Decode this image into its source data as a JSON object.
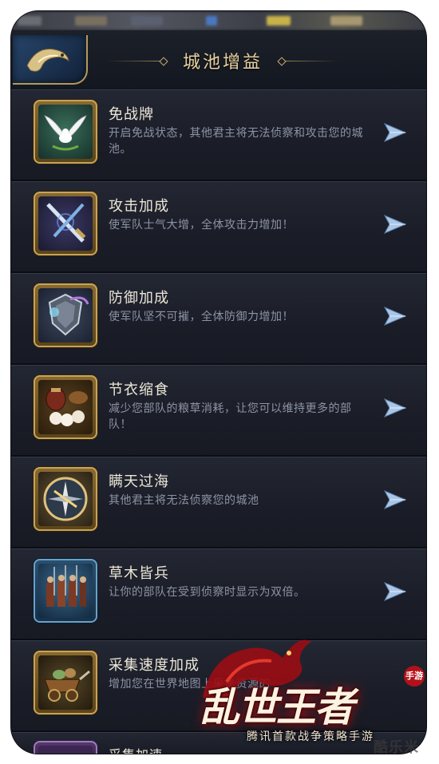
{
  "header": {
    "title": "城池增益"
  },
  "items": [
    {
      "name": "免战牌",
      "desc": "开启免战状态，其他君主将无法侦察和攻击您的城池。",
      "icon": "white-dove-icon"
    },
    {
      "name": "攻击加成",
      "desc": "使军队士气大增，全体攻击力增加！",
      "icon": "crossed-swords-icon"
    },
    {
      "name": "防御加成",
      "desc": "使军队坚不可摧，全体防御力增加！",
      "icon": "shield-armor-icon"
    },
    {
      "name": "节衣缩食",
      "desc": "减少您部队的粮草消耗，让您可以维持更多的部队！",
      "icon": "food-jar-buns-icon"
    },
    {
      "name": "瞒天过海",
      "desc": "其他君主将无法侦察您的城池",
      "icon": "compass-map-icon"
    },
    {
      "name": "草木皆兵",
      "desc": "让你的部队在受到侦察时显示为双倍。",
      "icon": "soldiers-group-icon"
    },
    {
      "name": "采集速度加成",
      "desc": "增加您在世界地图上采集资源的",
      "icon": "resource-cart-icon"
    },
    {
      "name": "采集加速",
      "desc": "",
      "icon": "gather-boost-icon"
    }
  ],
  "logo": {
    "title": "乱世王者",
    "badge": "手游",
    "tagline": "腾讯首款战争策略手游"
  },
  "watermark": "酷乐米",
  "colors": {
    "background": "#151820",
    "title_gold": "#e8d3a0",
    "item_name": "#ece6d6",
    "item_desc": "#8d93a5",
    "arrow": "#a9c6e8",
    "icon_frame_gold": "#c7a35a"
  }
}
